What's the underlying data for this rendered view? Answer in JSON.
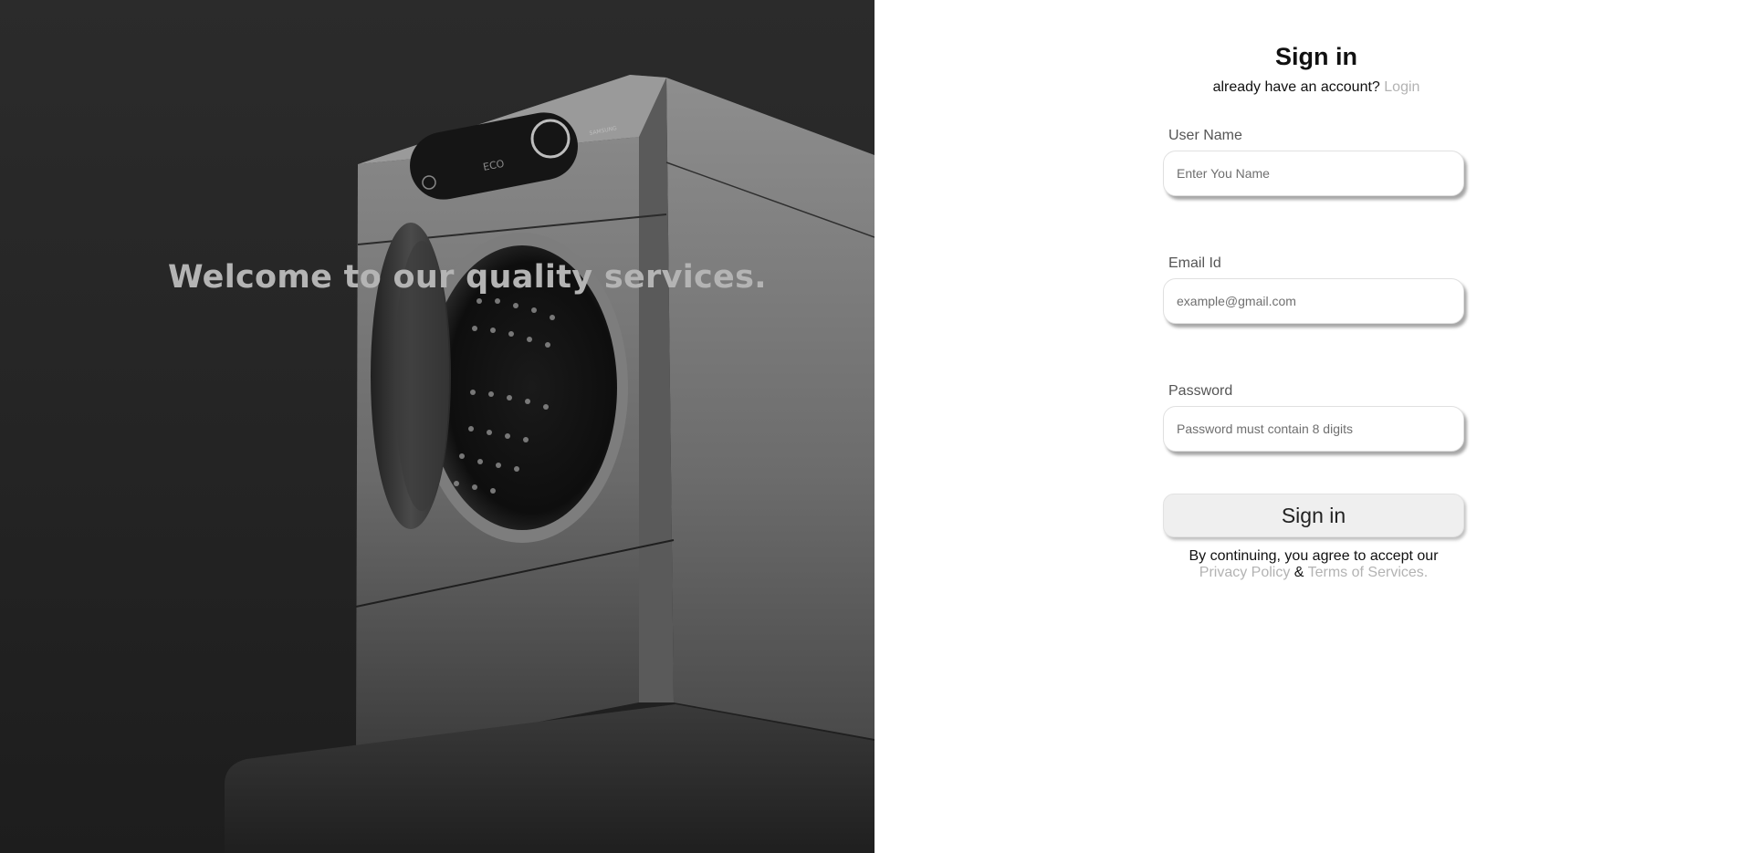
{
  "hero": {
    "headline": "Welcome to our quality services.",
    "brand_mark": "SAMSUNG",
    "panel_label": "ECO"
  },
  "form": {
    "title": "Sign in",
    "subtitle_text": "already have an account?",
    "login_link": "Login",
    "fields": [
      {
        "label": "User Name",
        "placeholder": "Enter You Name",
        "value": ""
      },
      {
        "label": "Email Id",
        "placeholder": "example@gmail.com",
        "value": ""
      },
      {
        "label": "Password",
        "placeholder": "Password must contain 8 digits",
        "value": ""
      }
    ],
    "submit_label": "Sign in",
    "legal_text": "By continuing, you agree to accept our",
    "privacy_link": "Privacy Policy",
    "legal_joiner": "&",
    "terms_link": "Terms of Services."
  },
  "colors": {
    "hero_bg": "#262626",
    "headline": "#b4b4b4",
    "muted_link": "#b3b3b3",
    "button_bg": "#efefef"
  }
}
